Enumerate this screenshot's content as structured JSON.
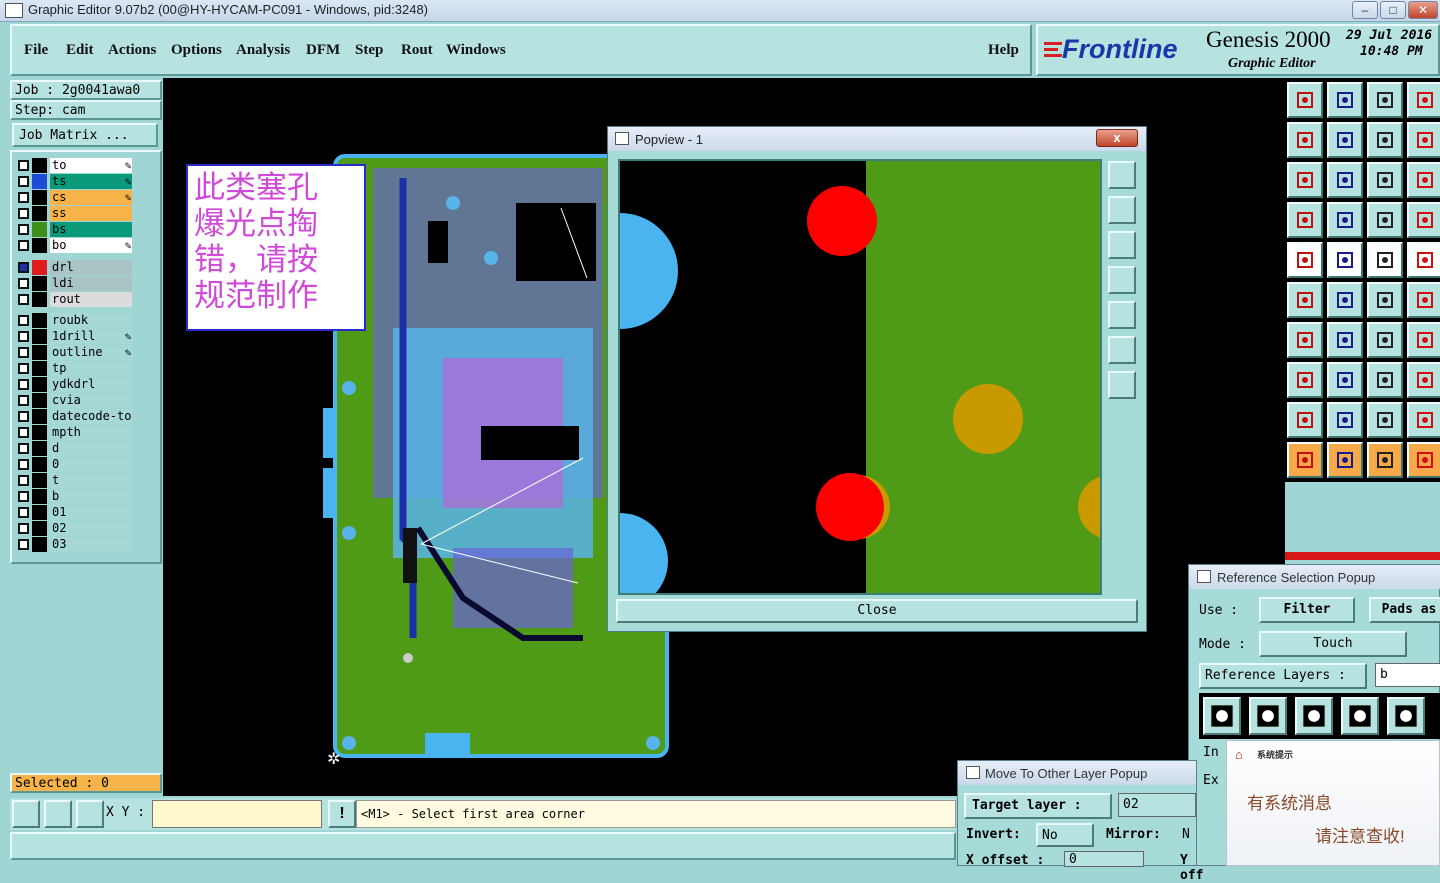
{
  "window": {
    "title": "Graphic Editor 9.07b2 (00@HY-HYCAM-PC091 - Windows, pid:3248)"
  },
  "menu": [
    "File",
    "Edit",
    "Actions",
    "Options",
    "Analysis",
    "DFM",
    "Step",
    "Rout",
    "Windows"
  ],
  "help_label": "Help",
  "brand": {
    "logo": "Frontline",
    "product": "Genesis 2000",
    "subtitle": "Graphic Editor",
    "date": "29 Jul 2016",
    "time": "10:48 PM"
  },
  "job": {
    "job_line": "Job : 2g0041awa0",
    "step_line": "Step: cam",
    "matrix_button": "Job Matrix ..."
  },
  "layers": [
    {
      "name": "to",
      "color": "#ffffff",
      "swatch": "#000000",
      "pen": true
    },
    {
      "name": "ts",
      "color": "#0a9a7a",
      "swatch": "#1e4bd8",
      "pen": true
    },
    {
      "name": "cs",
      "color": "#f6b34a",
      "swatch": "#000000",
      "pen": true
    },
    {
      "name": "ss",
      "color": "#f6b34a",
      "swatch": "#000000",
      "pen": false
    },
    {
      "name": "bs",
      "color": "#0a9a7a",
      "swatch": "#3d8f1a",
      "pen": false
    },
    {
      "name": "bo",
      "color": "#ffffff",
      "swatch": "#000000",
      "pen": true
    },
    {
      "name": "drl",
      "color": "#a8c4c4",
      "swatch": "#e01c1c",
      "pen": false,
      "active": true
    },
    {
      "name": "ldi",
      "color": "#a8c4c4",
      "swatch": "#000000",
      "pen": false
    },
    {
      "name": "rout",
      "color": "#dcdcdc",
      "swatch": "#000000",
      "pen": false
    },
    {
      "name": "roubk",
      "color": "#a6d8d6",
      "swatch": "#000000",
      "pen": false
    },
    {
      "name": "1drill",
      "color": "#a6d8d6",
      "swatch": "#000000",
      "pen": true
    },
    {
      "name": "outline",
      "color": "#a6d8d6",
      "swatch": "#000000",
      "pen": true
    },
    {
      "name": "tp",
      "color": "#a6d8d6",
      "swatch": "#000000",
      "pen": false
    },
    {
      "name": "ydkdrl",
      "color": "#a6d8d6",
      "swatch": "#000000",
      "pen": false
    },
    {
      "name": "cvia",
      "color": "#a6d8d6",
      "swatch": "#000000",
      "pen": false
    },
    {
      "name": "datecode-to",
      "color": "#a6d8d6",
      "swatch": "#000000",
      "pen": false
    },
    {
      "name": "mpth",
      "color": "#a6d8d6",
      "swatch": "#000000",
      "pen": false
    },
    {
      "name": "d",
      "color": "#a6d8d6",
      "swatch": "#000000",
      "pen": false
    },
    {
      "name": "0",
      "color": "#a6d8d6",
      "swatch": "#000000",
      "pen": false
    },
    {
      "name": "t",
      "color": "#a6d8d6",
      "swatch": "#000000",
      "pen": false
    },
    {
      "name": "b",
      "color": "#a6d8d6",
      "swatch": "#000000",
      "pen": false
    },
    {
      "name": "01",
      "color": "#a6d8d6",
      "swatch": "#000000",
      "pen": false
    },
    {
      "name": "02",
      "color": "#a6d8d6",
      "swatch": "#000000",
      "pen": false
    },
    {
      "name": "03",
      "color": "#a6d8d6",
      "swatch": "#000000",
      "pen": false
    }
  ],
  "selected": "Selected : 0",
  "annotation": {
    "line1": "此类塞孔",
    "line2": "爆光点掏",
    "line3": "错，请按",
    "line4": "规范制作"
  },
  "popview": {
    "title": "Popview - 1",
    "close_label": "Close",
    "close_x": "x"
  },
  "ref_popup": {
    "title": "Reference Selection Popup",
    "use_label": "Use   :",
    "use_value": "Filter",
    "pads_label": "Pads as",
    "mode_label": "Mode  :",
    "mode_value": "Touch",
    "ref_layers_label": "Reference Layers :",
    "ref_layers_value": "b",
    "in_label": "In",
    "ex_label": "Ex"
  },
  "move_popup": {
    "title": "Move To Other Layer Popup",
    "target_label": "Target layer :",
    "target_value": "02",
    "invert_label": "Invert:",
    "invert_value": "No",
    "mirror_label": "Mirror:",
    "mirror_value": "N",
    "xoffset_label": "X offset :",
    "xoffset_value": "0",
    "yoff_label": "Y off"
  },
  "sys_msg": {
    "title": "系统提示",
    "line1": "有系统消息",
    "line2": "请注意查收!"
  },
  "status": {
    "xy_label": "X Y :",
    "xy_value": "",
    "prompt": "<M1> - Select first area corner",
    "bang": "!"
  },
  "colors": {
    "panel": "#b6e3e0",
    "canvas": "#000000",
    "board": "#3d8f1a",
    "pad_red": "#ff0000",
    "pad_gold": "#c89a00",
    "pad_blue": "#4ab4f0"
  }
}
